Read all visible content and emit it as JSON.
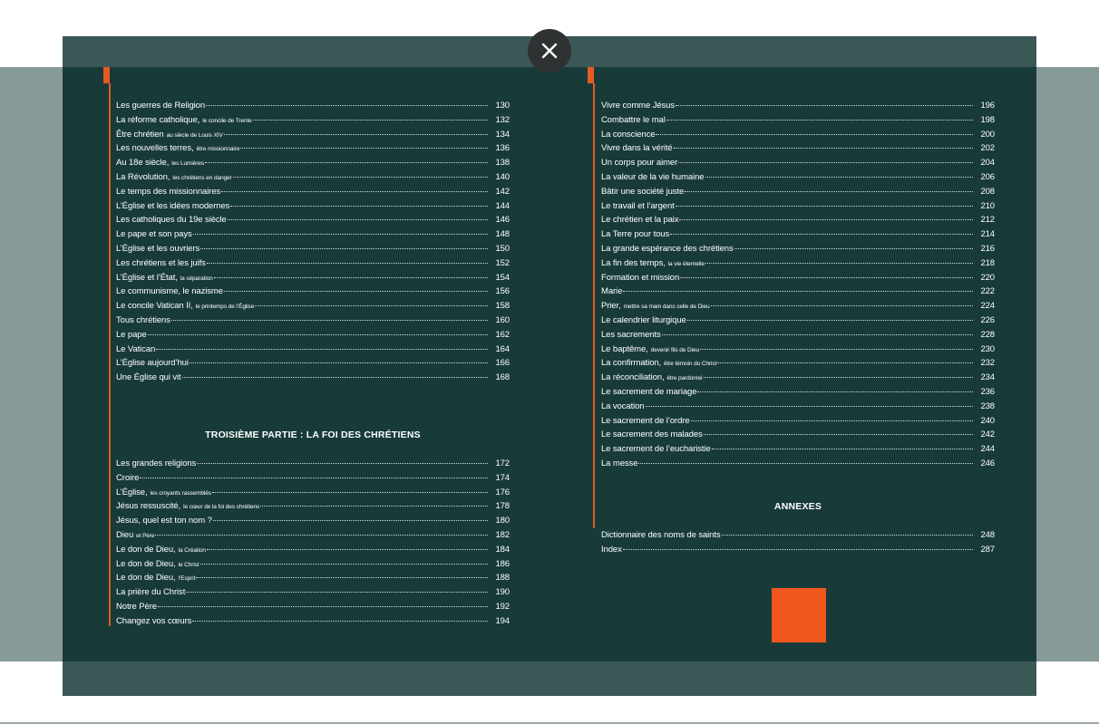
{
  "viewer": {
    "close_label": "×"
  },
  "toc_left_top": [
    {
      "title": "Les guerres de Religion",
      "sub": "",
      "page": "130"
    },
    {
      "title": "La réforme catholique,",
      "sub": "le concile de Trente",
      "page": "132"
    },
    {
      "title": "Être chrétien",
      "sub": "au siècle de Louis XIV",
      "page": "134"
    },
    {
      "title": "Les nouvelles terres,",
      "sub": "être missionnaire",
      "page": "136"
    },
    {
      "title": "Au 18e siècle,",
      "sub": "les Lumières",
      "page": "138"
    },
    {
      "title": "La Révolution,",
      "sub": "les chrétiens en danger",
      "page": "140"
    },
    {
      "title": "Le temps des missionnaires",
      "sub": "",
      "page": "142"
    },
    {
      "title": "L’Église et les idées modernes",
      "sub": "",
      "page": "144"
    },
    {
      "title": "Les catholiques du 19e siècle",
      "sub": "",
      "page": "146"
    },
    {
      "title": "Le pape et son pays",
      "sub": "",
      "page": "148"
    },
    {
      "title": "L’Église et les ouvriers",
      "sub": "",
      "page": "150"
    },
    {
      "title": "Les chrétiens et les juifs",
      "sub": "",
      "page": "152"
    },
    {
      "title": "L’Église et l’État,",
      "sub": "la séparation",
      "page": "154"
    },
    {
      "title": "Le communisme, le nazisme",
      "sub": "",
      "page": "156"
    },
    {
      "title": "Le concile Vatican II,",
      "sub": "le printemps de l’Église",
      "page": "158"
    },
    {
      "title": "Tous chrétiens",
      "sub": "",
      "page": "160"
    },
    {
      "title": "Le pape",
      "sub": "",
      "page": "162"
    },
    {
      "title": "Le Vatican",
      "sub": "",
      "page": "164"
    },
    {
      "title": "L’Église aujourd’hui",
      "sub": "",
      "page": "166"
    },
    {
      "title": "Une Église qui vit",
      "sub": "",
      "page": "168"
    }
  ],
  "section_third": "TROISIÈME PARTIE : LA FOI DES CHRÉTIENS",
  "toc_left_bottom": [
    {
      "title": "Les grandes religions",
      "sub": "",
      "page": "172"
    },
    {
      "title": "Croire",
      "sub": "",
      "page": "174"
    },
    {
      "title": "L’Église,",
      "sub": "les croyants rassemblés",
      "page": "176"
    },
    {
      "title": "Jésus ressuscité,",
      "sub": "le cœur de la foi des chrétiens",
      "page": "178"
    },
    {
      "title": "Jésus, quel est ton nom ?",
      "sub": "",
      "page": "180"
    },
    {
      "title": "Dieu",
      "sub": "et Père",
      "page": "182"
    },
    {
      "title": "Le don de Dieu,",
      "sub": "la Création",
      "page": "184"
    },
    {
      "title": "Le don de Dieu,",
      "sub": "le Christ",
      "page": "186"
    },
    {
      "title": "Le don de Dieu,",
      "sub": "l’Esprit",
      "page": "188"
    },
    {
      "title": "La prière du Christ",
      "sub": "",
      "page": "190"
    },
    {
      "title": "Notre Père",
      "sub": "",
      "page": "192"
    },
    {
      "title": "Changez vos cœurs",
      "sub": "",
      "page": "194"
    }
  ],
  "toc_right_top": [
    {
      "title": "Vivre comme Jésus",
      "sub": "",
      "page": "196"
    },
    {
      "title": "Combattre le mal",
      "sub": "",
      "page": "198"
    },
    {
      "title": "La conscience",
      "sub": "",
      "page": "200"
    },
    {
      "title": "Vivre dans la vérité",
      "sub": "",
      "page": "202"
    },
    {
      "title": "Un corps pour aimer",
      "sub": "",
      "page": "204"
    },
    {
      "title": "La valeur de la vie humaine",
      "sub": "",
      "page": "206"
    },
    {
      "title": "Bâtir une société juste",
      "sub": "",
      "page": "208"
    },
    {
      "title": "Le travail et l’argent",
      "sub": "",
      "page": "210"
    },
    {
      "title": "Le chrétien et la paix",
      "sub": "",
      "page": "212"
    },
    {
      "title": "La Terre pour tous",
      "sub": "",
      "page": "214"
    },
    {
      "title": "La grande espérance des chrétiens",
      "sub": "",
      "page": "216"
    },
    {
      "title": "La fin des temps,",
      "sub": "la vie éternelle",
      "page": "218"
    },
    {
      "title": "Formation et mission",
      "sub": "",
      "page": "220"
    },
    {
      "title": "Marie",
      "sub": "",
      "page": "222"
    },
    {
      "title": "Prier,",
      "sub": "mettre sa main dans celle de Dieu",
      "page": "224"
    },
    {
      "title": "Le calendrier liturgique",
      "sub": "",
      "page": "226"
    },
    {
      "title": "Les sacrements",
      "sub": "",
      "page": "228"
    },
    {
      "title": "Le baptême,",
      "sub": "devenir fils de Dieu",
      "page": "230"
    },
    {
      "title": "La confirmation,",
      "sub": "être témoin du Christ",
      "page": "232"
    },
    {
      "title": "La réconciliation,",
      "sub": "être pardonné",
      "page": "234"
    },
    {
      "title": "Le sacrement de mariage",
      "sub": "",
      "page": "236"
    },
    {
      "title": "La vocation",
      "sub": "",
      "page": "238"
    },
    {
      "title": "Le sacrement de l’ordre",
      "sub": "",
      "page": "240"
    },
    {
      "title": "Le sacrement des malades",
      "sub": "",
      "page": "242"
    },
    {
      "title": "Le sacrement de l’eucharistie",
      "sub": "",
      "page": "244"
    },
    {
      "title": "La messe",
      "sub": "",
      "page": "246"
    }
  ],
  "section_annexes": "ANNEXES",
  "toc_right_bottom": [
    {
      "title": "Dictionnaire des noms de saints",
      "sub": "",
      "page": "248"
    },
    {
      "title": "Index",
      "sub": "",
      "page": "287"
    }
  ]
}
